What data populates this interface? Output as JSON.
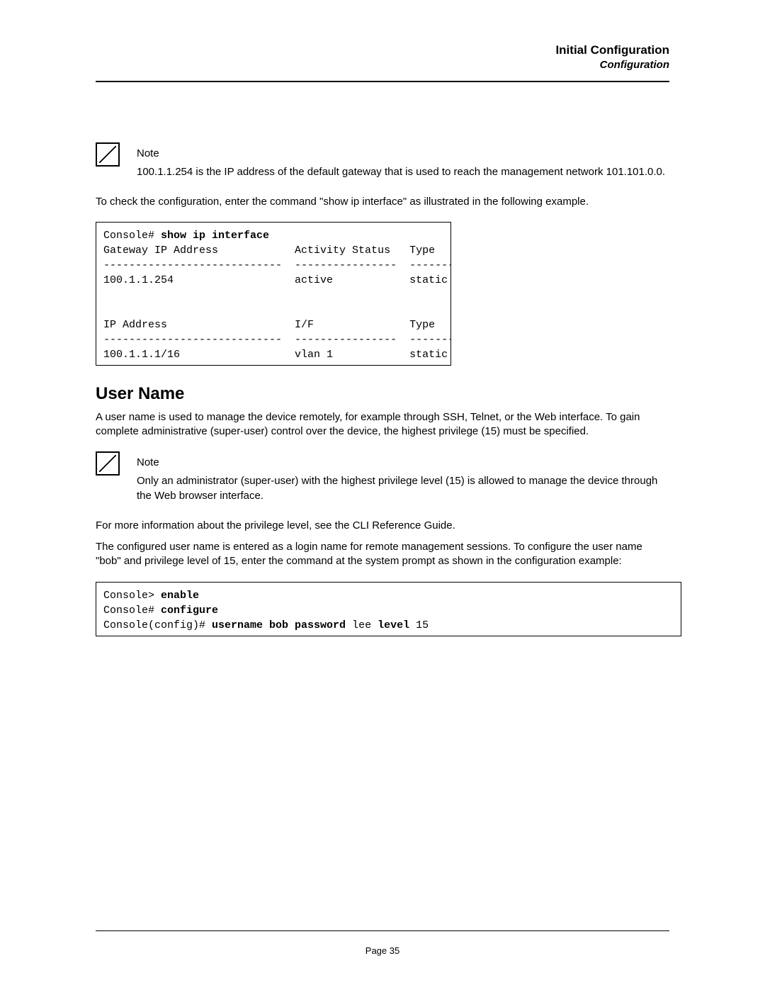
{
  "header": {
    "title": "Initial Configuration",
    "subtitle": "Configuration"
  },
  "note1": {
    "label": "Note",
    "body": "100.1.1.254 is the IP address of the default gateway that is used to reach the management network 101.101.0.0."
  },
  "para1": "To check the configuration, enter the command \"show ip interface\" as illustrated in the following example.",
  "terminal1": {
    "line1_prefix": "Console# ",
    "line1_cmd": "show ip interface",
    "block": "\nGateway IP Address            Activity Status   Type\n----------------------------  ----------------  ---------\n100.1.1.254                   active            static\n\n\nIP Address                    I/F               Type\n----------------------------  ----------------  ---------\n100.1.1.1/16                  vlan 1            static"
  },
  "section_title": "User Name",
  "para2": "A user name is used to manage the device remotely, for example through SSH, Telnet, or the Web interface. To gain complete administrative (super-user) control over the device, the highest privilege (15) must be specified.",
  "note2": {
    "label": "Note",
    "body": "Only an administrator (super-user) with the highest privilege level (15) is allowed to manage the device through the Web browser interface."
  },
  "para3": "For more information about the privilege level, see the CLI Reference Guide.",
  "para4": "The configured user name is entered as a login name for remote management sessions. To configure the user name \"bob\" and privilege level of 15, enter the command at the system prompt as shown in the configuration example:",
  "terminal2": {
    "l1_prefix": "Console> ",
    "l1_cmd": "enable",
    "l2_prefix": "Console# ",
    "l2_cmd": "configure",
    "l3_prefix": "Console(config)# ",
    "l3_cmd_a": "username bob password",
    "l3_mid": " lee ",
    "l3_cmd_b": "level",
    "l3_tail": " 15"
  },
  "footer": {
    "page": "Page 35"
  }
}
